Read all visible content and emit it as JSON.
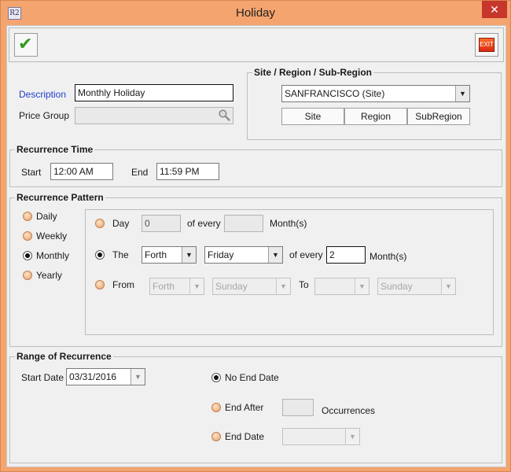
{
  "window": {
    "title": "Holiday",
    "app_icon_text": "R2",
    "close_glyph": "✕"
  },
  "toolbar": {
    "save_glyph": "✔",
    "exit_text": "EXIT"
  },
  "form": {
    "description_label": "Description",
    "description_value": "Monthly Holiday",
    "price_group_label": "Price Group",
    "price_group_value": ""
  },
  "site_region": {
    "title": "Site / Region / Sub-Region",
    "selected": "SANFRANCISCO (Site)",
    "buttons": [
      "Site",
      "Region",
      "SubRegion"
    ]
  },
  "recurrence_time": {
    "title": "Recurrence Time",
    "start_label": "Start",
    "start_value": "12:00 AM",
    "end_label": "End",
    "end_value": "11:59 PM"
  },
  "recurrence_pattern": {
    "title": "Recurrence Pattern",
    "types": [
      {
        "label": "Daily",
        "selected": false
      },
      {
        "label": "Weekly",
        "selected": false
      },
      {
        "label": "Monthly",
        "selected": true
      },
      {
        "label": "Yearly",
        "selected": false
      }
    ],
    "day_row": {
      "label": "Day",
      "value": "0",
      "of_every": "of every",
      "months_value": "",
      "months_label": "Month(s)",
      "selected": false
    },
    "the_row": {
      "label": "The",
      "ordinal": "Forth",
      "weekday": "Friday",
      "of_every": "of every",
      "months_value": "2",
      "months_label": "Month(s)",
      "selected": true
    },
    "from_row": {
      "label": "From",
      "from_ordinal": "Forth",
      "from_weekday": "Sunday",
      "to_label": "To",
      "to_ordinal": "",
      "to_weekday": "Sunday",
      "selected": false
    }
  },
  "range": {
    "title": "Range of Recurrence",
    "start_date_label": "Start Date",
    "start_date_value": "03/31/2016",
    "no_end_label": "No End Date",
    "end_after_label": "End After",
    "end_after_value": "",
    "occurrences_label": "Occurrences",
    "end_date_label": "End Date",
    "end_date_value": "",
    "selected": "no_end"
  }
}
